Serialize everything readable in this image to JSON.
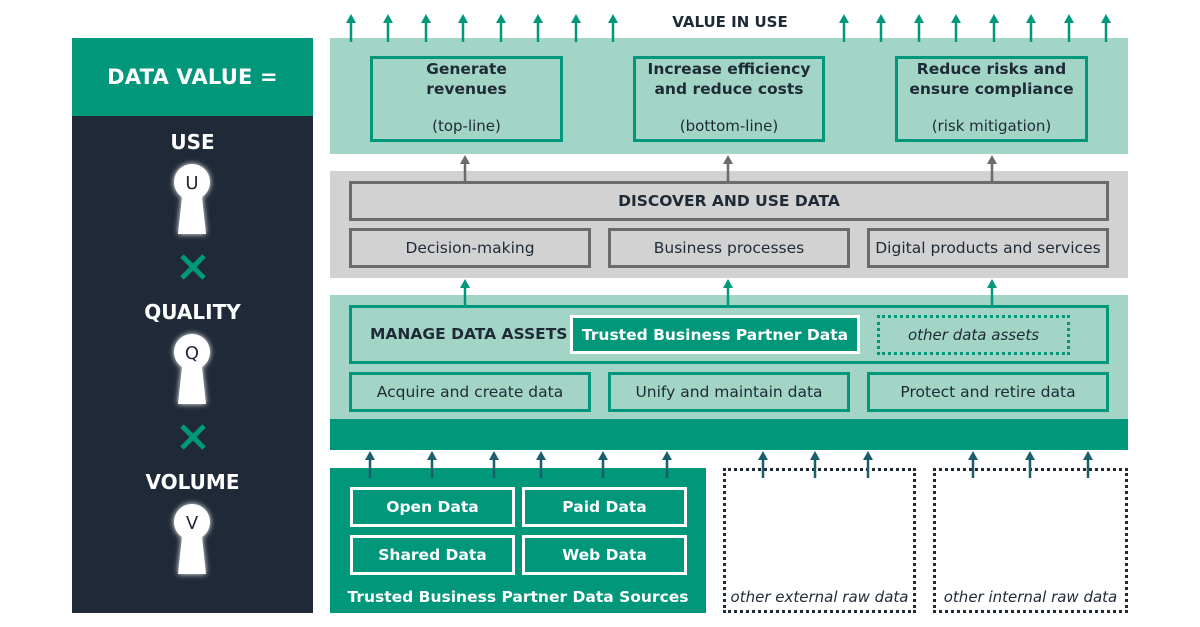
{
  "colors": {
    "brand_green": "#00977a",
    "light_green": "#a3d5c7",
    "dark_navy": "#1f2937",
    "grey_panel": "#d2d2d2",
    "grey_border": "#6b6b6b",
    "arrow_dark": "#1b5e6b",
    "arrow_grey": "#6b6b6b"
  },
  "formula": {
    "title": "DATA VALUE =",
    "factors": [
      {
        "label": "USE",
        "letter": "U",
        "icon": "keyhole-icon"
      },
      {
        "label": "QUALITY",
        "letter": "Q",
        "icon": "keyhole-icon"
      },
      {
        "label": "VOLUME",
        "letter": "V",
        "icon": "keyhole-icon"
      }
    ],
    "operator": "×"
  },
  "value_in_use": {
    "title": "VALUE IN USE",
    "boxes": [
      {
        "title_line1": "Generate",
        "title_line2": "revenues",
        "subtitle": "(top-line)"
      },
      {
        "title_line1": "Increase efficiency",
        "title_line2": "and reduce costs",
        "subtitle": "(bottom-line)"
      },
      {
        "title_line1": "Reduce risks and",
        "title_line2": "ensure compliance",
        "subtitle": "(risk mitigation)"
      }
    ]
  },
  "discover": {
    "title": "DISCOVER AND USE DATA",
    "items": [
      "Decision-making",
      "Business processes",
      "Digital products and services"
    ]
  },
  "manage": {
    "title": "MANAGE DATA ASSETS",
    "highlight": "Trusted Business Partner Data",
    "other": "other data assets",
    "items": [
      "Acquire and create data",
      "Unify and maintain data",
      "Protect and retire data"
    ]
  },
  "sources": {
    "items": [
      "Open Data",
      "Paid Data",
      "Shared Data",
      "Web Data"
    ],
    "label": "Trusted Business Partner Data Sources",
    "other_external": "other external raw data",
    "other_internal": "other internal raw data"
  }
}
